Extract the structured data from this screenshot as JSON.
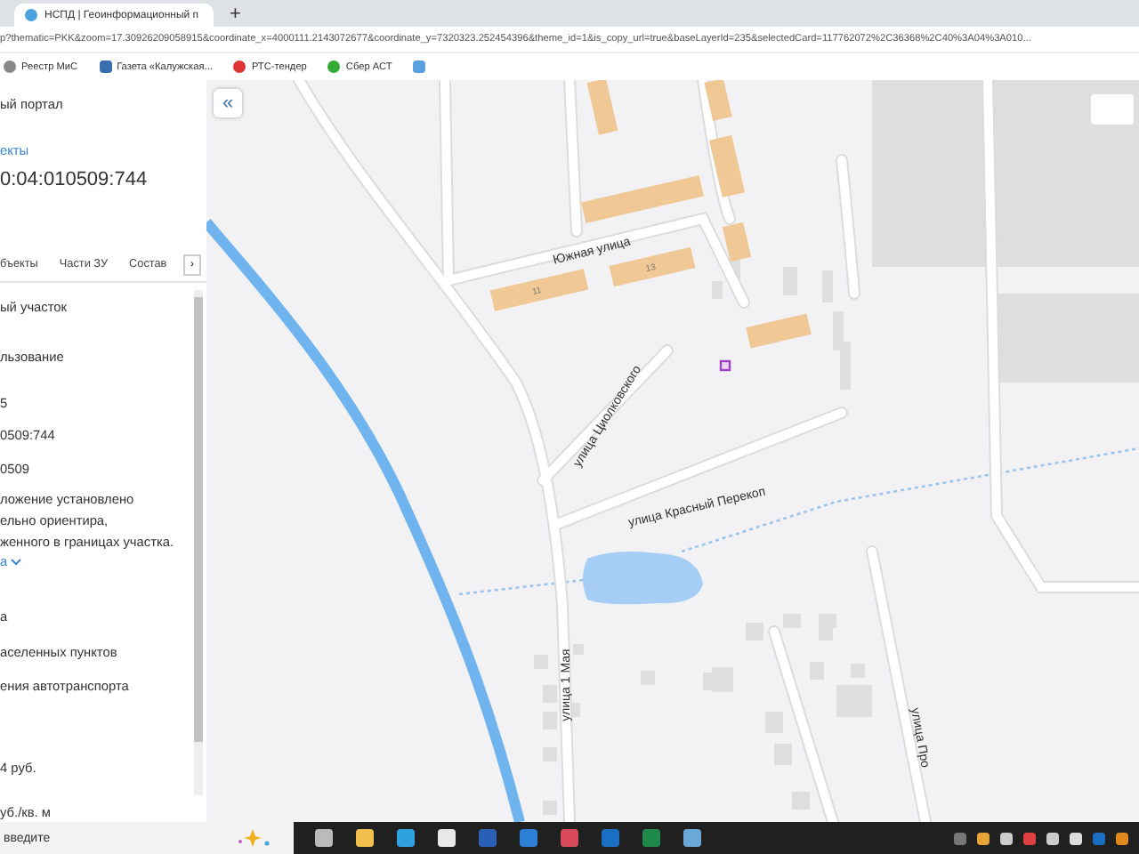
{
  "browser": {
    "tab_title": "НСПД | Геоинформационный п",
    "new_tab_glyph": "+",
    "address": "p?thematic=PKK&zoom=17.30926209058915&coordinate_x=4000111.2143072677&coordinate_y=7320323.252454396&theme_id=1&is_copy_url=true&baseLayerId=235&selectedCard=117762072%2C36368%2C40%3A04%3A010...",
    "bookmarks": [
      {
        "label": "Реестр МиС"
      },
      {
        "label": "Газета «Калужская..."
      },
      {
        "label": "РТС-тендер"
      },
      {
        "label": "Сбер АСТ"
      }
    ]
  },
  "panel": {
    "portal_title": "ый портал",
    "link": "екты",
    "cadastral_number": "0:04:010509:744",
    "next_glyph": "›",
    "tabs": [
      {
        "label": "бъекты",
        "selected": false
      },
      {
        "label": "Части ЗУ",
        "selected": false
      },
      {
        "label": "Состав",
        "selected": false
      }
    ],
    "rows": [
      {
        "kind": "text",
        "text": "ый участок"
      },
      {
        "kind": "text",
        "text": "льзование"
      },
      {
        "kind": "text",
        "text": "5"
      },
      {
        "kind": "text",
        "text": "0509:744"
      },
      {
        "kind": "text",
        "text": "0509"
      },
      {
        "kind": "paragraph",
        "lines": [
          "ложение установлено",
          "ельно ориентира,",
          "женного в границах участка."
        ]
      },
      {
        "kind": "link",
        "text": "а"
      },
      {
        "kind": "text",
        "text": "а"
      },
      {
        "kind": "text",
        "text": "аселенных пунктов"
      },
      {
        "kind": "text",
        "text": "ения автотранспорта"
      },
      {
        "kind": "text",
        "text": "4 руб."
      },
      {
        "kind": "text",
        "text": "уб./кв. м"
      }
    ]
  },
  "map": {
    "collapse_glyph": "«",
    "streets": [
      "Южная улица",
      "улица Циолковского",
      "улица Красный Перекоп",
      "улица 1 Мая",
      "улица Про"
    ],
    "building_numbers": [
      "11",
      "13"
    ]
  },
  "taskbar": {
    "search_placeholder": "введите"
  }
}
